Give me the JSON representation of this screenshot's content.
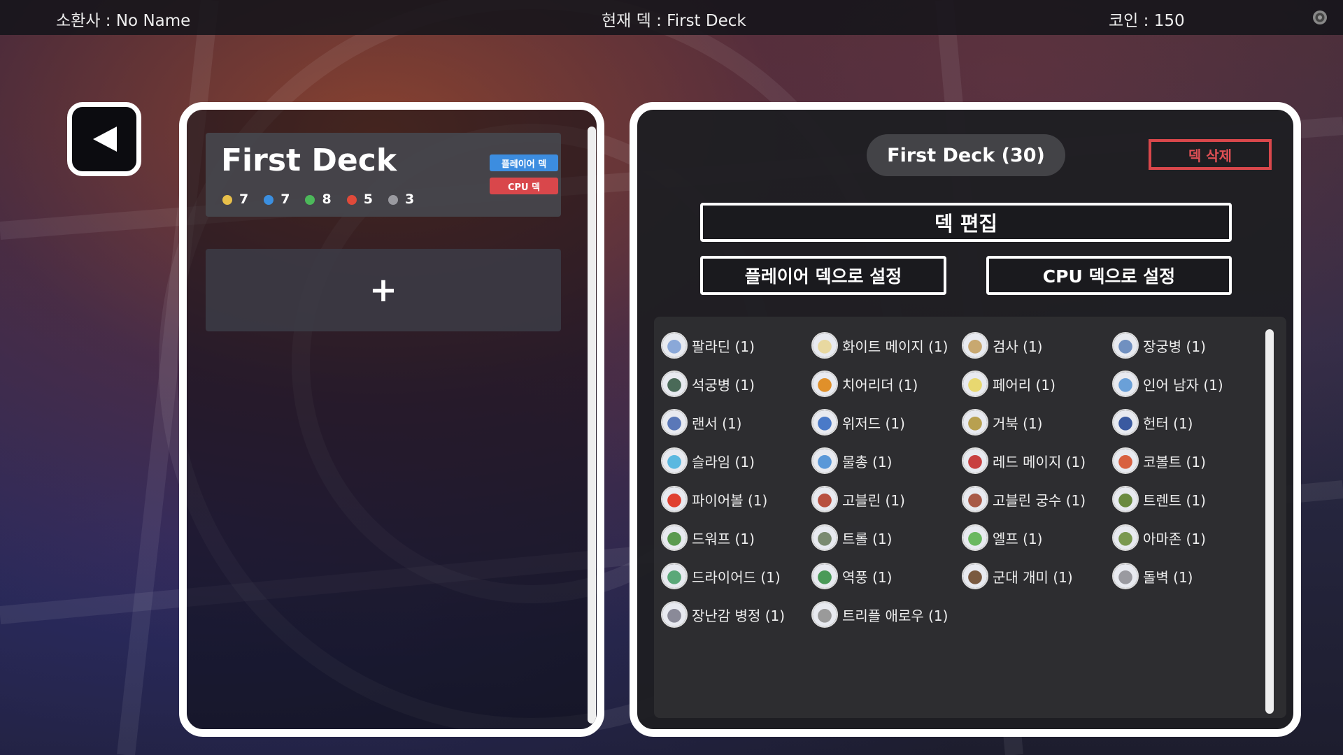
{
  "topbar": {
    "summoner": "소환사 : No Name",
    "current_deck": "현재 덱 : First Deck",
    "coins": "코인 : 150"
  },
  "deck_list": {
    "deck": {
      "name": "First Deck",
      "badge_player": "플레이어 덱",
      "badge_cpu": "CPU 덱",
      "elements": [
        {
          "icon": "light-icon",
          "count": "7",
          "color": "#e8c04a"
        },
        {
          "icon": "water-icon",
          "count": "7",
          "color": "#3b8fe0"
        },
        {
          "icon": "nature-icon",
          "count": "8",
          "color": "#4cb85a"
        },
        {
          "icon": "fire-icon",
          "count": "5",
          "color": "#e04a3a"
        },
        {
          "icon": "neutral-icon",
          "count": "3",
          "color": "#9a9aa0"
        }
      ]
    },
    "add_label": "+"
  },
  "detail": {
    "title": "First Deck (30)",
    "delete_label": "덱 삭제",
    "edit_label": "덱 편집",
    "set_player_label": "플레이어 덱으로 설정",
    "set_cpu_label": "CPU 덱으로 설정",
    "cards": [
      {
        "name": "팔라딘 (1)",
        "color": "#8aa8d8"
      },
      {
        "name": "화이트 메이지 (1)",
        "color": "#e8d8a0"
      },
      {
        "name": "검사 (1)",
        "color": "#c8a870"
      },
      {
        "name": "장궁병 (1)",
        "color": "#7090c0"
      },
      {
        "name": "석궁병 (1)",
        "color": "#4a6a58"
      },
      {
        "name": "치어리더 (1)",
        "color": "#e0902a"
      },
      {
        "name": "페어리 (1)",
        "color": "#e8d870"
      },
      {
        "name": "인어 남자 (1)",
        "color": "#6aa0d8"
      },
      {
        "name": "랜서 (1)",
        "color": "#5a78b8"
      },
      {
        "name": "위저드 (1)",
        "color": "#4a7ac8"
      },
      {
        "name": "거북 (1)",
        "color": "#b8a050"
      },
      {
        "name": "헌터 (1)",
        "color": "#3a5aa0"
      },
      {
        "name": "슬라임 (1)",
        "color": "#5ab8e0"
      },
      {
        "name": "물총 (1)",
        "color": "#5a98d8"
      },
      {
        "name": "레드 메이지 (1)",
        "color": "#c84040"
      },
      {
        "name": "코볼트 (1)",
        "color": "#d86040"
      },
      {
        "name": "파이어볼 (1)",
        "color": "#e04030"
      },
      {
        "name": "고블린 (1)",
        "color": "#b85040"
      },
      {
        "name": "고블린 궁수 (1)",
        "color": "#a85a48"
      },
      {
        "name": "트렌트 (1)",
        "color": "#6a8a40"
      },
      {
        "name": "드워프 (1)",
        "color": "#5a9a50"
      },
      {
        "name": "트롤 (1)",
        "color": "#7a8a70"
      },
      {
        "name": "엘프 (1)",
        "color": "#6ab860"
      },
      {
        "name": "아마존 (1)",
        "color": "#7a9850"
      },
      {
        "name": "드라이어드 (1)",
        "color": "#5aa878"
      },
      {
        "name": "역풍 (1)",
        "color": "#4a9a58"
      },
      {
        "name": "군대 개미 (1)",
        "color": "#7a5a40"
      },
      {
        "name": "돌벽 (1)",
        "color": "#9a9aa0"
      },
      {
        "name": "장난감 병정 (1)",
        "color": "#8a8a98"
      },
      {
        "name": "트리플 애로우 (1)",
        "color": "#9a9a9a"
      }
    ]
  }
}
